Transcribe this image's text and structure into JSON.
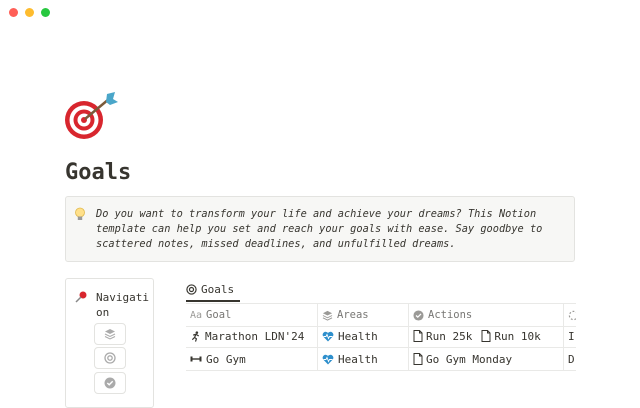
{
  "window": {
    "controls": [
      {
        "name": "close",
        "color": "#ff5f57"
      },
      {
        "name": "minimize",
        "color": "#febc2e"
      },
      {
        "name": "maximize",
        "color": "#28c840"
      }
    ]
  },
  "page": {
    "icon": "target-dart-icon",
    "title": "Goals"
  },
  "callout": {
    "icon": "lightbulb-icon",
    "text": "Do you want to transform your life and achieve your dreams? This Notion template can help you set and reach your goals with ease. Say goodbye to scattered notes, missed deadlines, and unfulfilled dreams."
  },
  "navigation": {
    "icon": "pushpin-icon",
    "label": "Navigation",
    "buttons": [
      "layers-icon",
      "target-icon",
      "check-circle-icon"
    ]
  },
  "database": {
    "tab_label": "Goals",
    "tab_icon": "target-icon",
    "columns": [
      {
        "label": "Goal",
        "icon": "text-property-icon"
      },
      {
        "label": "Areas",
        "icon": "layers-icon"
      },
      {
        "label": "Actions",
        "icon": "check-circle-icon"
      },
      {
        "label": "",
        "icon": "loading-icon"
      }
    ],
    "rows": [
      {
        "goal": "Marathon LDN'24",
        "goal_icon": "running-icon",
        "area": "Health",
        "area_icon": "heart-pulse-icon",
        "actions": [
          "Run 25k",
          "Run 10k"
        ],
        "extra": "I"
      },
      {
        "goal": "Go Gym",
        "goal_icon": "dumbbell-icon",
        "area": "Health",
        "area_icon": "heart-pulse-icon",
        "actions": [
          "Go Gym Monday"
        ],
        "extra": "D"
      }
    ]
  }
}
